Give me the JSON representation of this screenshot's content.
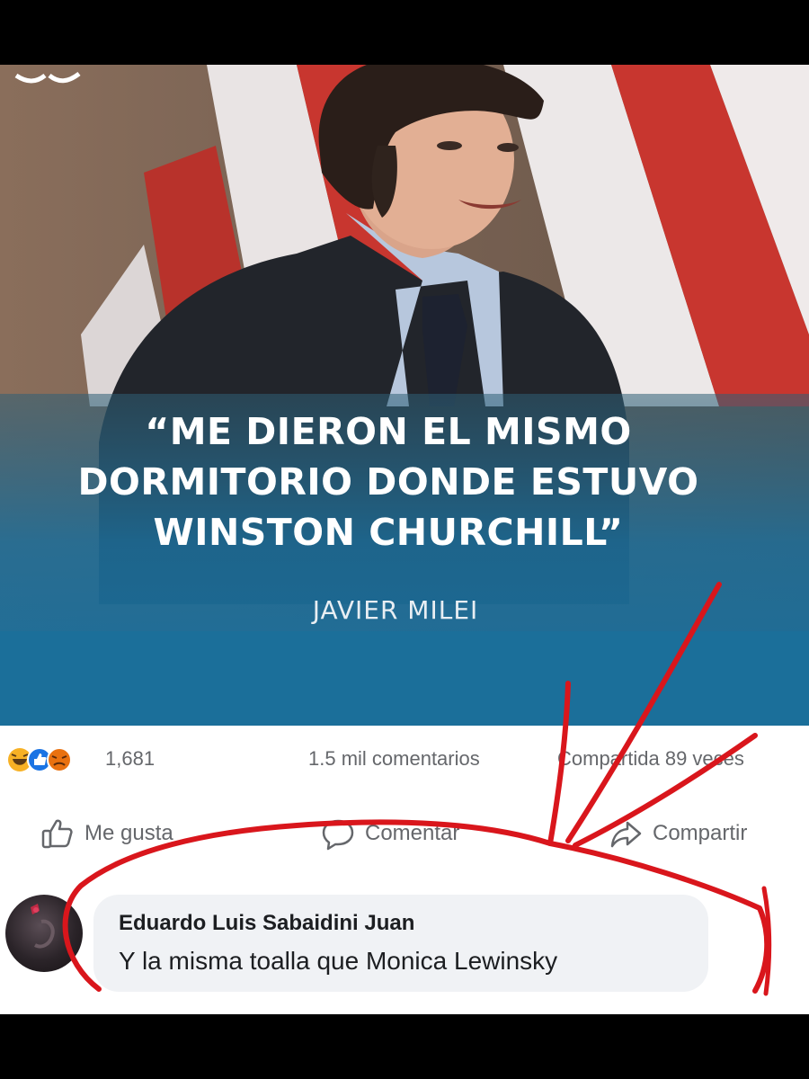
{
  "post": {
    "quote_lines": [
      "“ME DIERON EL MISMO",
      "DORMITORIO DONDE ESTUVO",
      "WINSTON CHURCHILL”"
    ],
    "author": "JAVIER MILEI"
  },
  "stats": {
    "reaction_icons": [
      "haha-icon",
      "like-icon",
      "angry-icon"
    ],
    "reaction_count": "1,681",
    "comments": "1.5 mil comentarios",
    "shares": "Compartida 89 veces"
  },
  "actions": {
    "like_label": "Me gusta",
    "comment_label": "Comentar",
    "share_label": "Compartir"
  },
  "comment": {
    "author": "Eduardo Luis Sabaidini Juan",
    "text": "Y la misma toalla que Monica Lewinsky"
  },
  "colors": {
    "annotation_red": "#d9161c",
    "caption_blue": "#1b6f9a",
    "flag_red": "#c8362f",
    "fb_gray": "#65676b",
    "bubble_bg": "#f0f2f5"
  }
}
